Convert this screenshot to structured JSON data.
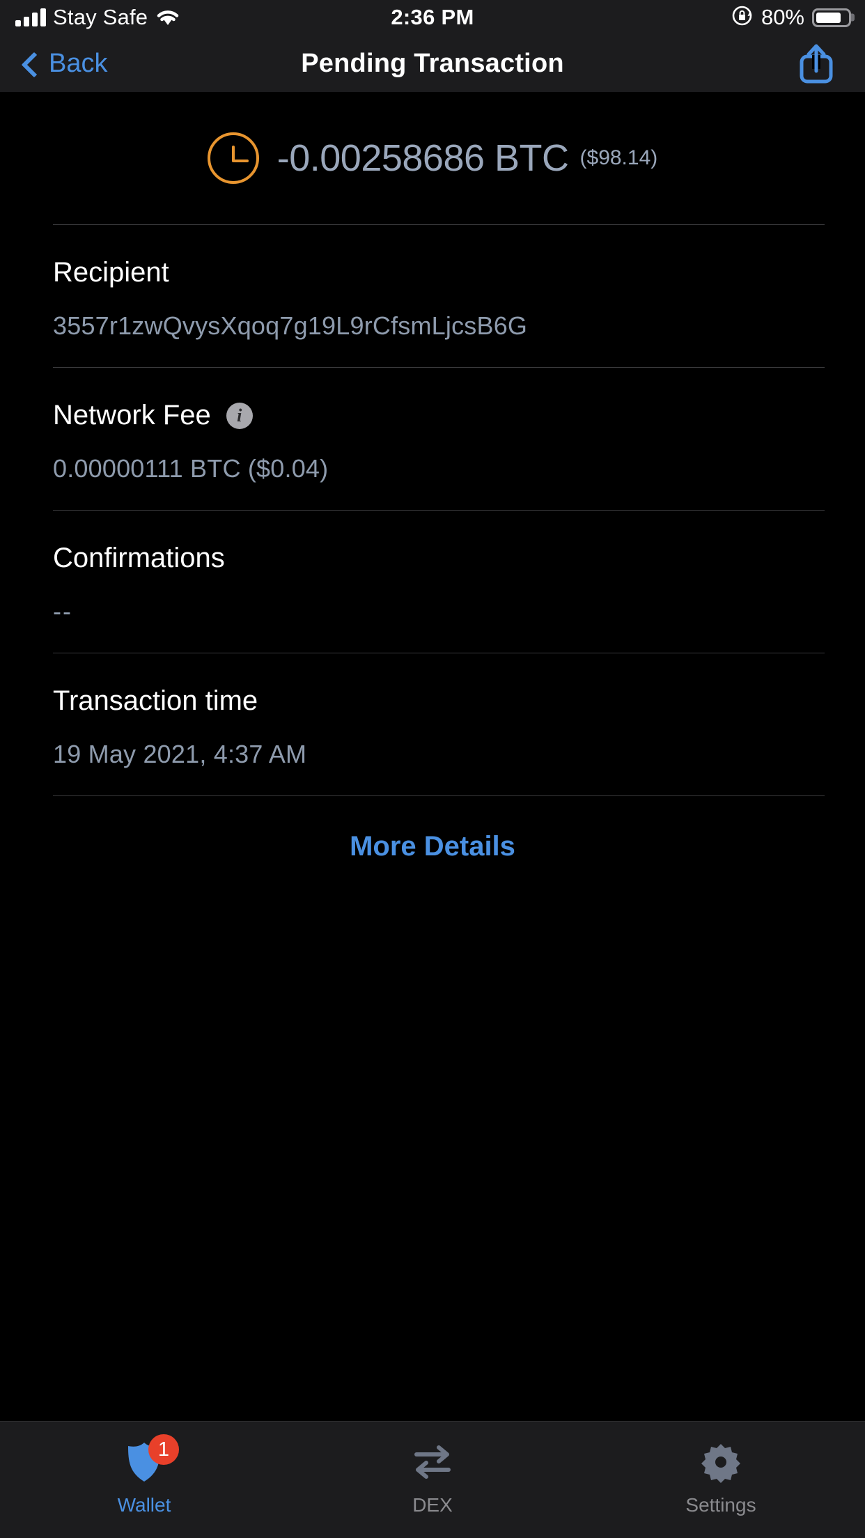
{
  "status_bar": {
    "carrier": "Stay Safe",
    "time": "2:36 PM",
    "battery_percent": "80%",
    "signal_icon": "signal-bars-icon",
    "wifi_icon": "wifi-icon",
    "rotation_lock_icon": "rotation-lock-icon",
    "battery_icon": "battery-icon"
  },
  "nav": {
    "back_label": "Back",
    "title": "Pending Transaction",
    "share_icon": "share-icon"
  },
  "summary": {
    "status_icon": "pending-clock-icon",
    "amount": "-0.00258686 BTC",
    "fiat": "($98.14)"
  },
  "rows": [
    {
      "title": "Recipient",
      "value": "3557r1zwQvysXqoq7g19L9rCfsmLjcsB6G",
      "has_info": false
    },
    {
      "title": "Network Fee",
      "value": "0.00000111 BTC ($0.04)",
      "has_info": true,
      "info_icon": "info-icon"
    },
    {
      "title": "Confirmations",
      "value": "--",
      "has_info": false
    },
    {
      "title": "Transaction time",
      "value": "19 May 2021, 4:37 AM",
      "has_info": false
    }
  ],
  "more_details_label": "More Details",
  "tabs": [
    {
      "label": "Wallet",
      "icon": "shield-icon",
      "badge": "1",
      "active": true
    },
    {
      "label": "DEX",
      "icon": "swap-arrows-icon",
      "badge": null,
      "active": false
    },
    {
      "label": "Settings",
      "icon": "gear-icon",
      "badge": null,
      "active": false
    }
  ],
  "colors": {
    "accent_blue": "#4a90e2",
    "pending_orange": "#e8952f",
    "badge_red": "#e8402a",
    "value_gray": "#8e9bad",
    "background": "#000000",
    "bar_background": "#1c1c1e"
  }
}
